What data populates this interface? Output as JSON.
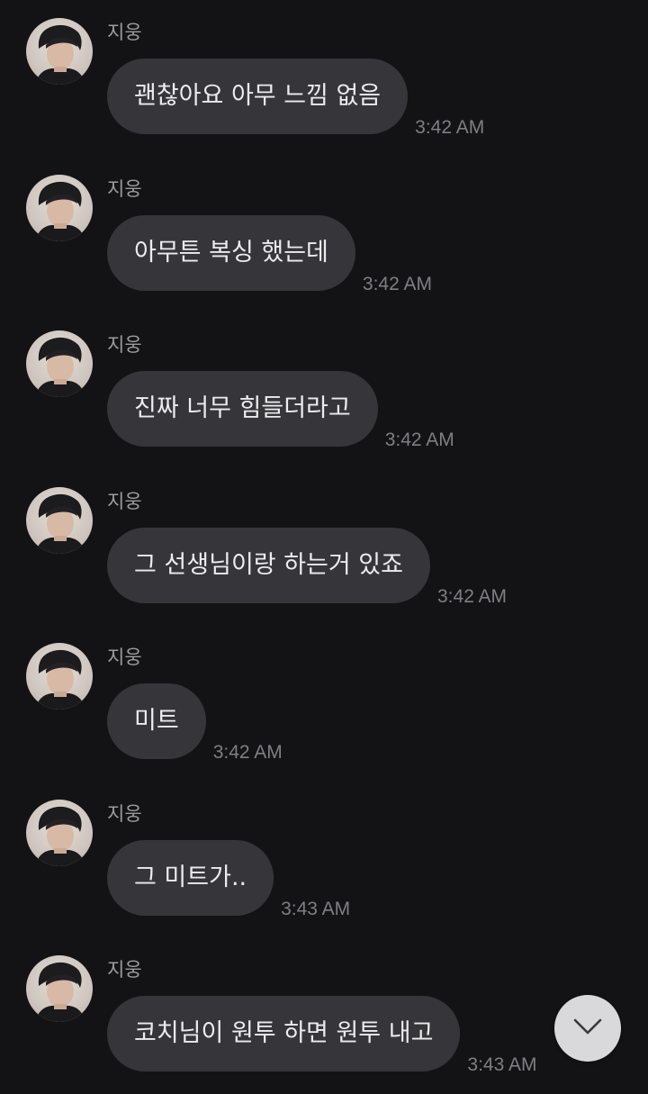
{
  "chat": {
    "messages": [
      {
        "sender": "지웅",
        "text": "괜찮아요 아무 느낌 없음",
        "time": "3:42 AM"
      },
      {
        "sender": "지웅",
        "text": "아무튼 복싱 했는데",
        "time": "3:42 AM"
      },
      {
        "sender": "지웅",
        "text": "진짜 너무 힘들더라고",
        "time": "3:42 AM"
      },
      {
        "sender": "지웅",
        "text": "그 선생님이랑 하는거 있죠",
        "time": "3:42 AM"
      },
      {
        "sender": "지웅",
        "text": "미트",
        "time": "3:42 AM"
      },
      {
        "sender": "지웅",
        "text": "그 미트가..",
        "time": "3:43 AM"
      },
      {
        "sender": "지웅",
        "text": "코치님이 원투 하면 원투 내고",
        "time": "3:43 AM"
      }
    ]
  },
  "scroll_button": {
    "icon": "chevron-down-icon"
  },
  "colors": {
    "background": "#131316",
    "bubble": "#36363a",
    "bubble_text": "#ececef",
    "sender_name": "#9b9ba0",
    "timestamp": "#7e7e84",
    "scroll_button": "#d9d9dc"
  }
}
